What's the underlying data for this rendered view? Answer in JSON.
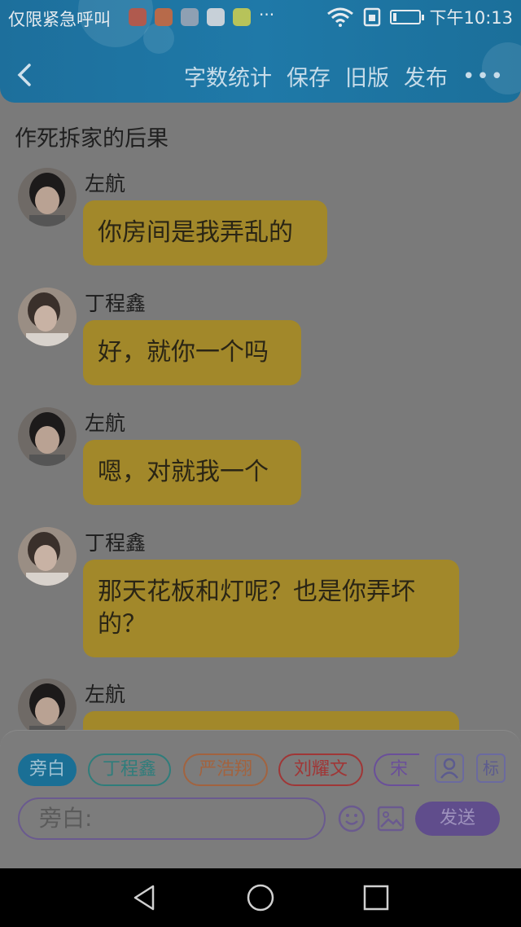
{
  "status_bar": {
    "carrier": "仅限紧急呼叫",
    "more": "···",
    "time": "下午10:13"
  },
  "toolbar": {
    "word_count": "字数统计",
    "save": "保存",
    "old_version": "旧版",
    "publish": "发布",
    "more": "•••"
  },
  "story": {
    "title": "作死拆家的后果"
  },
  "messages": [
    {
      "name": "左航",
      "text": "你房间是我弄乱的"
    },
    {
      "name": "丁程鑫",
      "text": "好，就你一个吗"
    },
    {
      "name": "左航",
      "text": "嗯，对就我一个"
    },
    {
      "name": "丁程鑫",
      "text": "那天花板和灯呢？也是你弄坏的？"
    },
    {
      "name": "左航",
      "text": ""
    }
  ],
  "composer": {
    "roles": [
      "旁白",
      "丁程鑫",
      "严浩翔",
      "刘耀文",
      "宋亚"
    ],
    "role_colors": [
      "#1a6f95",
      "#2f7d7b",
      "#a2633f",
      "#a03636",
      "#6a4f9a"
    ],
    "contact_icon": "person-icon",
    "tag_label": "标",
    "placeholder": "旁白:",
    "send": "发送"
  },
  "colors": {
    "header": "#1f79a8",
    "bubble": "#a2882a",
    "send": "#604d8c"
  }
}
